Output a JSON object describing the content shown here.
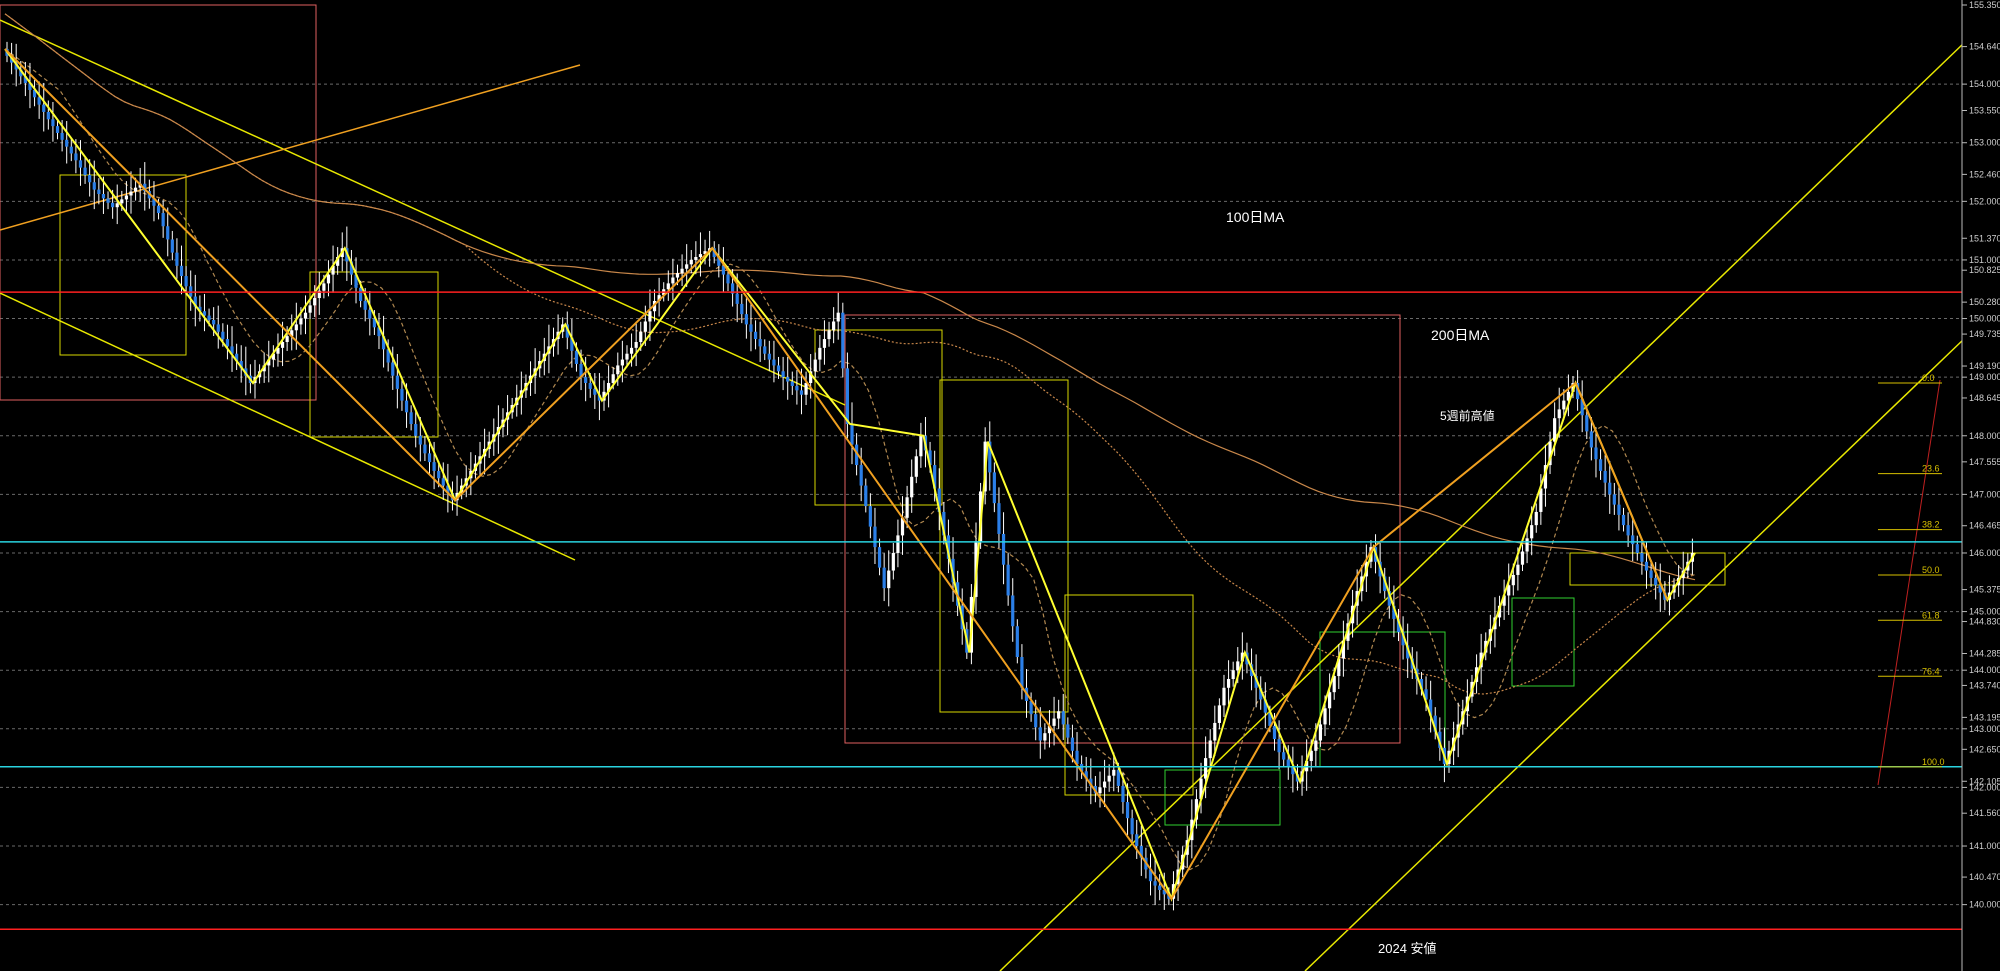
{
  "chart_data": {
    "type": "candlestick",
    "title": "",
    "ylim": [
      139.55,
      155.35
    ],
    "grid": true,
    "y_ticks": [
      155.35,
      154.64,
      154.0,
      153.55,
      153.0,
      152.46,
      152.0,
      151.37,
      151.0,
      150.825,
      150.28,
      150.0,
      149.735,
      149.19,
      149.0,
      148.645,
      148.0,
      147.555,
      147.0,
      146.465,
      146.0,
      145.375,
      145.0,
      144.83,
      144.285,
      144.0,
      143.74,
      143.195,
      143.0,
      142.65,
      142.105,
      142.0,
      141.56,
      141.0,
      140.47,
      140.0
    ],
    "highlighted_levels": [
      {
        "value": 150.45,
        "label": "150.4",
        "color": "#ff2020"
      },
      {
        "value": 146.189,
        "label": "146.189",
        "color": "#2ad4e0"
      },
      {
        "value": 142.353,
        "label": "142.353",
        "color": "#2ad4e0"
      },
      {
        "value": 139.58,
        "label": "139.58",
        "color": "#ff2020"
      }
    ],
    "annotations": [
      {
        "text": "100日MA"
      },
      {
        "text": "200日MA"
      },
      {
        "text": "5週前高値"
      },
      {
        "text": "2024 安値"
      }
    ],
    "fibonacci_levels": [
      "0.0",
      "23.6",
      "38.2",
      "50.0",
      "61.8",
      "76.4",
      "100.0"
    ],
    "price_path": [
      [
        0,
        154.6
      ],
      [
        6,
        153.9
      ],
      [
        10,
        153.4
      ],
      [
        16,
        152.7
      ],
      [
        20,
        152.2
      ],
      [
        24,
        151.9
      ],
      [
        30,
        152.3
      ],
      [
        34,
        151.8
      ],
      [
        38,
        150.9
      ],
      [
        42,
        150.2
      ],
      [
        46,
        149.9
      ],
      [
        50,
        149.4
      ],
      [
        54,
        148.9
      ],
      [
        58,
        149.3
      ],
      [
        62,
        149.7
      ],
      [
        66,
        150.1
      ],
      [
        70,
        150.6
      ],
      [
        74,
        151.2
      ],
      [
        78,
        150.3
      ],
      [
        82,
        149.7
      ],
      [
        86,
        148.8
      ],
      [
        90,
        148.0
      ],
      [
        94,
        147.4
      ],
      [
        98,
        146.9
      ],
      [
        102,
        147.4
      ],
      [
        106,
        147.9
      ],
      [
        110,
        148.4
      ],
      [
        114,
        148.9
      ],
      [
        118,
        149.4
      ],
      [
        122,
        149.9
      ],
      [
        126,
        149.0
      ],
      [
        130,
        148.6
      ],
      [
        134,
        149.2
      ],
      [
        138,
        149.6
      ],
      [
        142,
        150.3
      ],
      [
        146,
        150.7
      ],
      [
        150,
        151.0
      ],
      [
        154,
        151.2
      ],
      [
        158,
        150.6
      ],
      [
        162,
        149.9
      ],
      [
        166,
        149.4
      ],
      [
        170,
        149.0
      ],
      [
        174,
        148.7
      ],
      [
        178,
        149.5
      ],
      [
        182,
        150.1
      ],
      [
        184,
        148.2
      ],
      [
        188,
        146.8
      ],
      [
        192,
        145.4
      ],
      [
        196,
        146.6
      ],
      [
        200,
        148.0
      ],
      [
        202,
        147.5
      ],
      [
        206,
        145.9
      ],
      [
        210,
        144.3
      ],
      [
        212,
        146.2
      ],
      [
        214,
        147.9
      ],
      [
        218,
        145.8
      ],
      [
        222,
        143.7
      ],
      [
        226,
        142.8
      ],
      [
        230,
        143.3
      ],
      [
        234,
        142.4
      ],
      [
        238,
        141.9
      ],
      [
        242,
        142.3
      ],
      [
        246,
        141.2
      ],
      [
        250,
        140.4
      ],
      [
        254,
        140.1
      ],
      [
        258,
        141.1
      ],
      [
        262,
        142.5
      ],
      [
        266,
        143.7
      ],
      [
        270,
        144.3
      ],
      [
        274,
        143.5
      ],
      [
        278,
        142.6
      ],
      [
        282,
        142.1
      ],
      [
        286,
        142.8
      ],
      [
        290,
        143.9
      ],
      [
        294,
        145.1
      ],
      [
        298,
        146.1
      ],
      [
        302,
        145.1
      ],
      [
        306,
        144.2
      ],
      [
        310,
        143.5
      ],
      [
        314,
        142.4
      ],
      [
        318,
        143.3
      ],
      [
        322,
        144.3
      ],
      [
        326,
        145.1
      ],
      [
        330,
        145.8
      ],
      [
        334,
        146.7
      ],
      [
        338,
        148.3
      ],
      [
        342,
        148.9
      ],
      [
        346,
        147.8
      ],
      [
        350,
        147.0
      ],
      [
        354,
        146.3
      ],
      [
        358,
        145.7
      ],
      [
        362,
        145.2
      ],
      [
        366,
        145.7
      ],
      [
        368,
        146.0
      ]
    ]
  }
}
